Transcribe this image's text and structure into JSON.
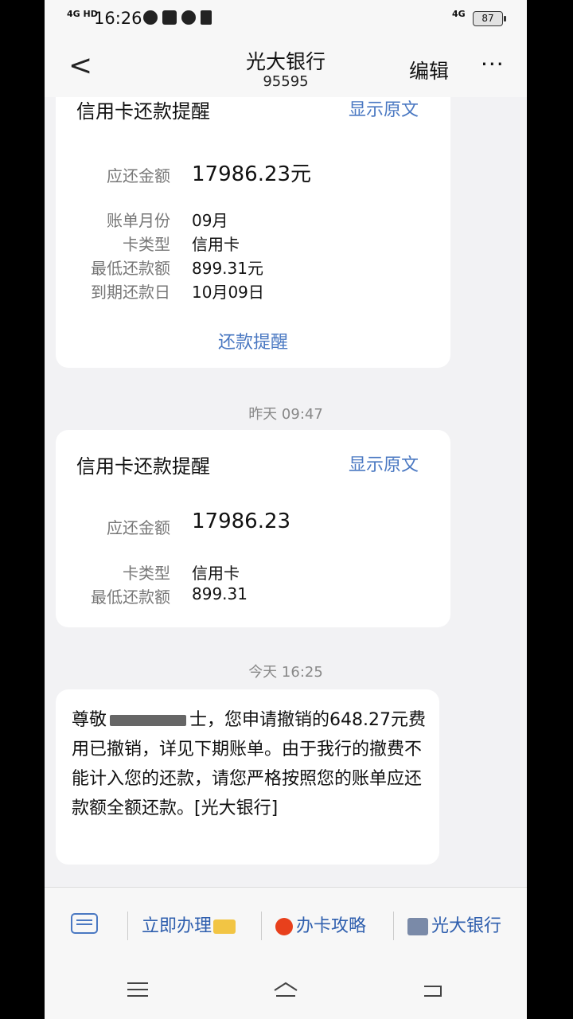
{
  "status_bar": {
    "signal_text": "4G HD",
    "time": "16:26",
    "icons": [
      "wechat-icon",
      "app-icon",
      "compass-icon",
      "mute-icon"
    ],
    "network_text": "4G",
    "battery": "87"
  },
  "header": {
    "title": "光大银行",
    "subtitle": "95595",
    "edit_label": "编辑",
    "more_label": "···",
    "back_icon": "chevron-left-icon"
  },
  "cards": [
    {
      "title": "信用卡还款提醒",
      "link": "显示原文",
      "rows": [
        {
          "label": "应还金额",
          "value": "17986.23元"
        },
        {
          "label": "账单月份",
          "value": "09月"
        },
        {
          "label": "卡类型",
          "value": "信用卡"
        },
        {
          "label": "最低还款额",
          "value": "899.31元"
        },
        {
          "label": "到期还款日",
          "value": "10月09日"
        }
      ],
      "action": "还款提醒"
    },
    {
      "title": "信用卡还款提醒",
      "link": "显示原文",
      "rows": [
        {
          "label": "应还金额",
          "value": "17986.23"
        },
        {
          "label": "卡类型",
          "value": "信用卡"
        },
        {
          "label": "最低还款额",
          "value": "899.31"
        }
      ]
    }
  ],
  "timestamps": [
    "昨天 09:47",
    "今天 16:25"
  ],
  "message": {
    "before_redacted": "尊敬",
    "after_redacted": "士，您申请撤销的648.27元费用已撤销，详见下期账单。由于我行的撤费不能计入您的还款，请您严格按照您的账单应还款额全额还款。[光大银行]"
  },
  "menu": {
    "keyboard_icon": "keyboard-icon",
    "items": [
      {
        "label": "立即办理",
        "icon": "card-icon"
      },
      {
        "label": "办卡攻略",
        "icon": "hot-icon"
      },
      {
        "label": "光大银行",
        "icon": "atm-icon"
      }
    ]
  },
  "colors": {
    "link": "#4a78c2",
    "menu_text": "#2f5fae",
    "background": "#f2f2f4",
    "card": "#ffffff"
  }
}
